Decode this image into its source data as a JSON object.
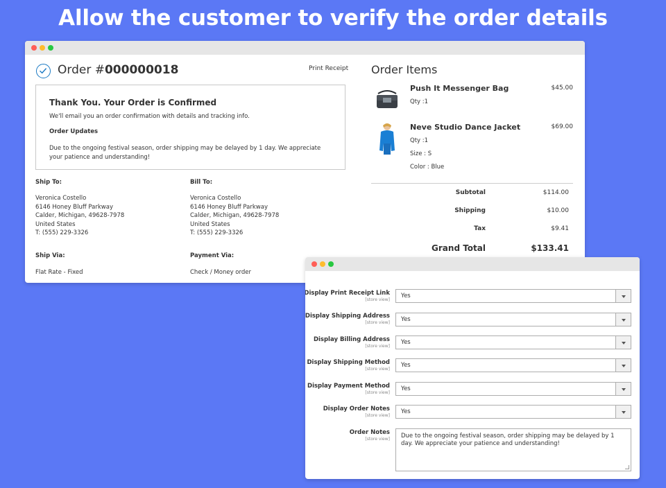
{
  "headline": "Allow the customer to verify the order details",
  "order": {
    "prefix": "Order #",
    "number": "000000018",
    "print_receipt": "Print Receipt",
    "confirm_title": "Thank You. Your Order is Confirmed",
    "confirm_email": "We'll email you an order confirmation with details and tracking info.",
    "updates_label": "Order Updates",
    "updates_text": "Due to the ongoing festival season, order shipping may be delayed by 1 day. We appreciate your patience and understanding!",
    "ship_to_label": "Ship To:",
    "ship_to": [
      "Veronica Costello",
      "6146 Honey Bluff Parkway",
      "Calder, Michigan, 49628-7978",
      "United States",
      "T: (555) 229-3326"
    ],
    "bill_to_label": "Bill To:",
    "bill_to": [
      "Veronica Costello",
      "6146 Honey Bluff Parkway",
      "Calder, Michigan, 49628-7978",
      "United States",
      "T: (555) 229-3326"
    ],
    "ship_via_label": "Ship Via:",
    "ship_via": "Flat Rate - Fixed",
    "payment_via_label": "Payment Via:",
    "payment_via": "Check / Money order"
  },
  "items": {
    "title": "Order Items",
    "list": [
      {
        "name": "Push It Messenger Bag",
        "price": "$45.00",
        "lines": [
          "Qty :1"
        ],
        "icon": "messenger-bag-image",
        "color": "#3a3f45"
      },
      {
        "name": "Neve Studio Dance Jacket",
        "price": "$69.00",
        "lines": [
          "Qty :1",
          "Size : S",
          "Color : Blue"
        ],
        "icon": "jacket-image",
        "color": "#1a7fd4"
      }
    ],
    "totals": [
      {
        "label": "Subtotal",
        "value": "$114.00"
      },
      {
        "label": "Shipping",
        "value": "$10.00"
      },
      {
        "label": "Tax",
        "value": "$9.41"
      }
    ],
    "grand_total_label": "Grand Total",
    "grand_total": "$133.41"
  },
  "config": {
    "scope": "[store view]",
    "rows": [
      {
        "label": "Display Print Receipt Link",
        "value": "Yes"
      },
      {
        "label": "Display Shipping Address",
        "value": "Yes"
      },
      {
        "label": "Display Billing Address",
        "value": "Yes"
      },
      {
        "label": "Display Shipping Method",
        "value": "Yes"
      },
      {
        "label": "Display Payment Method",
        "value": "Yes"
      },
      {
        "label": "Display Order Notes",
        "value": "Yes"
      }
    ],
    "notes_label": "Order Notes",
    "notes_value": "Due to the ongoing festival season, order shipping may be delayed by 1 day. We appreciate your patience and understanding!"
  }
}
